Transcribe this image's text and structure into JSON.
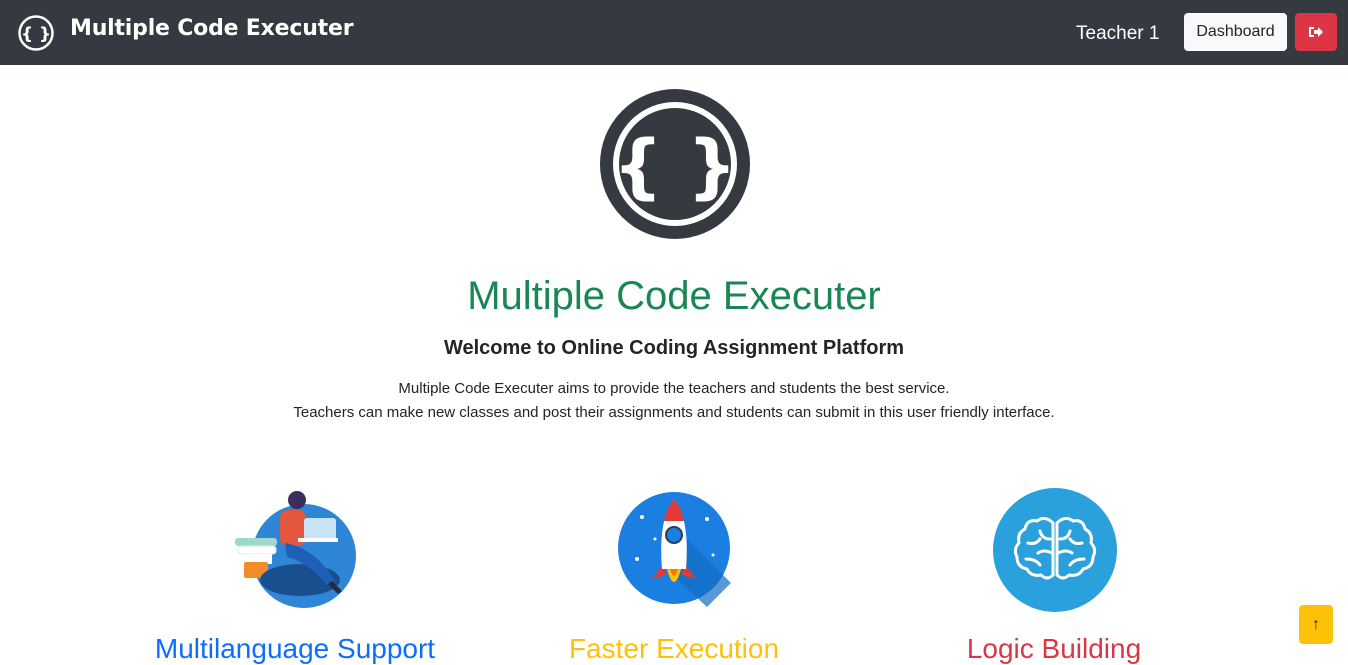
{
  "navbar": {
    "title": "Multiple Code Executer",
    "logo_icon": "curly-braces-icon",
    "user_name": "Teacher 1",
    "dashboard_label": "Dashboard",
    "logout_icon": "sign-out-icon",
    "bg_color": "#343a40"
  },
  "hero": {
    "logo_icon": "curly-braces-icon",
    "title": "Multiple Code Executer",
    "subtitle": "Welcome to Online Coding Assignment Platform",
    "description_line1": "Multiple Code Executer aims to provide the teachers and students the best service.",
    "description_line2": "Teachers can make new classes and post their assignments and students can submit in this user friendly interface.",
    "title_color": "#198754"
  },
  "features": [
    {
      "title": "Multilanguage Support",
      "icon": "person-laptop-illustration",
      "color": "#0d6efd"
    },
    {
      "title": "Faster Execution",
      "icon": "rocket-illustration",
      "color": "#ffc107"
    },
    {
      "title": "Logic Building",
      "icon": "brain-icon",
      "color": "#dc3545"
    }
  ],
  "scroll_top": {
    "label": "↑",
    "color": "#ffc107"
  }
}
